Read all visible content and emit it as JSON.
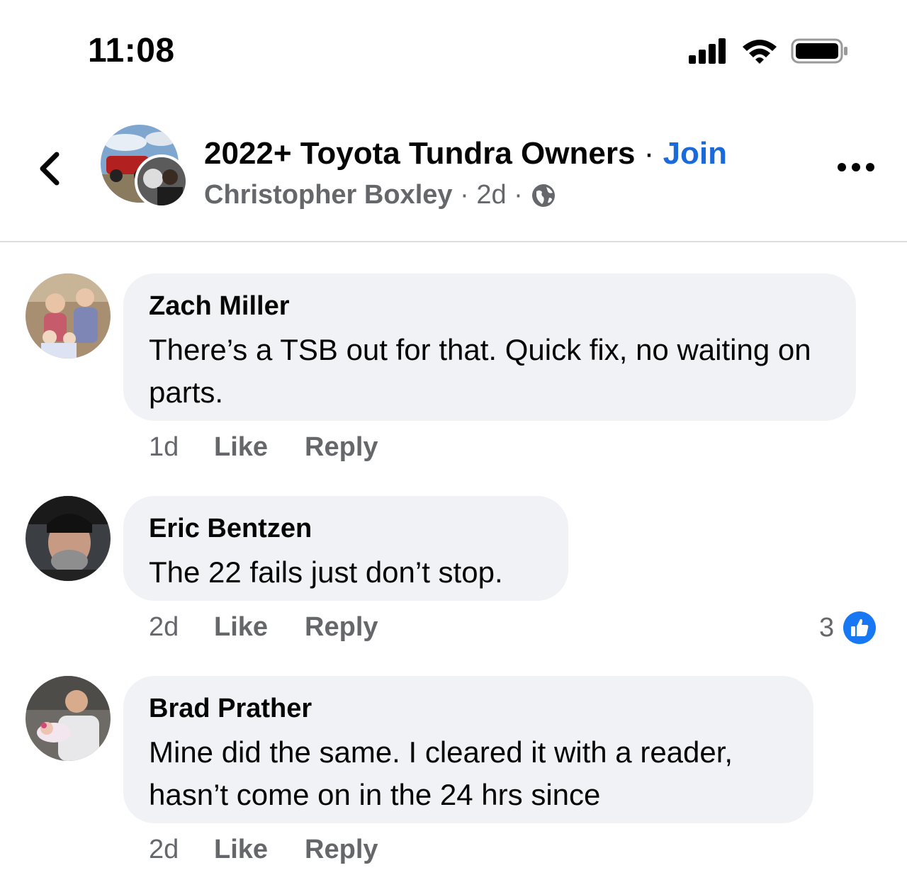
{
  "status_bar": {
    "time": "11:08",
    "icons": [
      "signal-icon",
      "wifi-icon",
      "battery-icon"
    ]
  },
  "header": {
    "back_icon": "chevron-left-icon",
    "group_name": "2022+ Toyota Tundra Owners",
    "separator": "·",
    "join_label": "Join",
    "poster_name": "Christopher Boxley",
    "post_age": "2d",
    "privacy_icon": "globe-icon",
    "more_icon": "more-horizontal-icon"
  },
  "colors": {
    "join_blue": "#1b6ad9",
    "bubble_bg": "#f0f2f5",
    "secondary_text": "#65676b",
    "like_blue": "#1877f2"
  },
  "comments": [
    {
      "author": "Zach Miller",
      "text": "There’s a TSB out for that. Quick fix, no waiting on parts.",
      "age": "1d",
      "like_label": "Like",
      "reply_label": "Reply"
    },
    {
      "author": "Eric Bentzen",
      "text": "The 22 fails just don’t stop.",
      "age": "2d",
      "like_label": "Like",
      "reply_label": "Reply",
      "reaction_count": "3",
      "reaction_icon": "thumbs-up-icon"
    },
    {
      "author": "Brad Prather",
      "text": "Mine did the same. I cleared it with a reader, hasn’t come on in the 24 hrs since",
      "age": "2d",
      "like_label": "Like",
      "reply_label": "Reply"
    }
  ]
}
